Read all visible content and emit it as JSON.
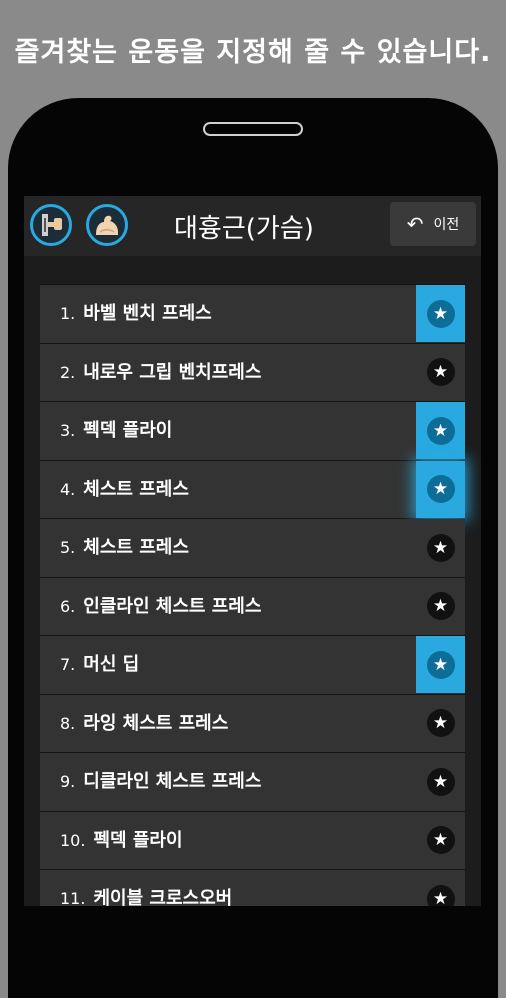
{
  "promo_text": "즐겨찾는 운동을 지정해 줄 수 있습니다.",
  "header": {
    "title": "대흉근(가슴)",
    "back_label": "이전",
    "icons": [
      "dumbbell-machine-icon",
      "flexed-arm-icon"
    ]
  },
  "accent_color": "#29a9e0",
  "exercises": [
    {
      "num": "1.",
      "name": "바벨 벤치 프레스",
      "favorite": true
    },
    {
      "num": "2.",
      "name": "내로우 그립 벤치프레스",
      "favorite": false
    },
    {
      "num": "3.",
      "name": "펙덱 플라이",
      "favorite": true
    },
    {
      "num": "4.",
      "name": "체스트 프레스",
      "favorite": true,
      "pressed": true
    },
    {
      "num": "5.",
      "name": "체스트 프레스",
      "favorite": false
    },
    {
      "num": "6.",
      "name": "인클라인 체스트 프레스",
      "favorite": false
    },
    {
      "num": "7.",
      "name": "머신 딥",
      "favorite": true
    },
    {
      "num": "8.",
      "name": "라잉 체스트 프레스",
      "favorite": false
    },
    {
      "num": "9.",
      "name": "디클라인 체스트 프레스",
      "favorite": false
    },
    {
      "num": "10.",
      "name": "펙덱 플라이",
      "favorite": false
    },
    {
      "num": "11.",
      "name": "케이블 크로스오버",
      "favorite": false
    }
  ]
}
